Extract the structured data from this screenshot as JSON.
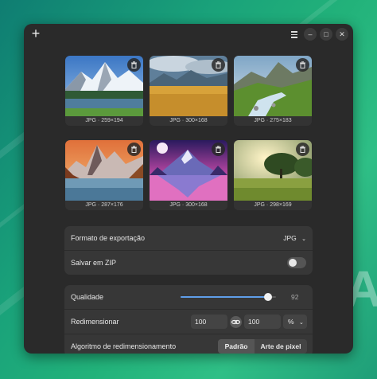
{
  "titlebar": {
    "add_icon": "plus-icon",
    "menu_icon": "hamburger-menu-icon",
    "minimize_glyph": "–",
    "maximize_glyph": "□",
    "close_glyph": "✕"
  },
  "images": [
    {
      "caption": "JPG · 259×194",
      "scene": "snowy-mountain-lake"
    },
    {
      "caption": "JPG · 300×168",
      "scene": "golden-field-mountains"
    },
    {
      "caption": "JPG · 275×183",
      "scene": "mountain-river-valley"
    },
    {
      "caption": "JPG · 287×176",
      "scene": "sunset-mountain-lake"
    },
    {
      "caption": "JPG · 300×168",
      "scene": "neon-mountain-reflection"
    },
    {
      "caption": "JPG · 298×169",
      "scene": "sunlit-tree-meadow"
    }
  ],
  "export": {
    "format_label": "Formato de exportação",
    "format_value": "JPG",
    "zip_label": "Salvar em ZIP",
    "zip_enabled": false
  },
  "quality": {
    "label": "Qualidade",
    "value": "92",
    "fraction": 0.92
  },
  "resize": {
    "label": "Redimensionar",
    "width": "100",
    "height": "100",
    "unit": "%",
    "algorithm_label": "Algoritmo de redimensionamento",
    "algorithm_options": [
      "Padrão",
      "Arte de pixel"
    ],
    "algorithm_selected": "Padrão"
  },
  "background_letter": "A",
  "colors": {
    "accent": "#5f9ee8",
    "window_bg": "#2a2a2a",
    "group_bg": "#373737"
  }
}
